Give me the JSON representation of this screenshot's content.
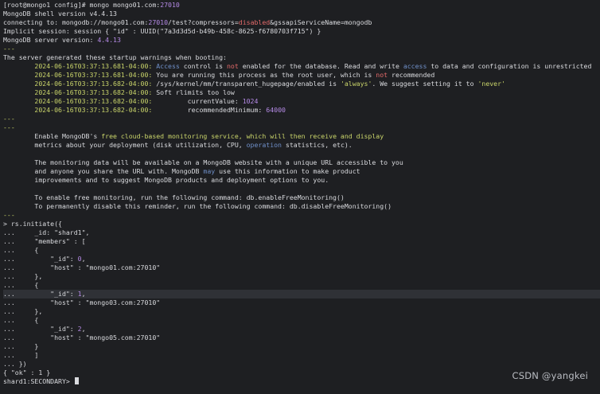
{
  "terminal": {
    "lines": [
      [
        {
          "t": "[root@mongo1 config]# ",
          "c": "host"
        },
        {
          "t": "mongo mongo01.com:",
          "c": "cmd"
        },
        {
          "t": "27010",
          "c": "num"
        }
      ],
      [
        {
          "t": "MongoDB shell version v4.4.13",
          "c": ""
        }
      ],
      [
        {
          "t": "connecting to: mongodb://mongo01.com:",
          "c": ""
        },
        {
          "t": "27010",
          "c": "num"
        },
        {
          "t": "/test?compressors=",
          "c": ""
        },
        {
          "t": "disabled",
          "c": "warn"
        },
        {
          "t": "&gssapiServiceName=mongodb",
          "c": ""
        }
      ],
      [
        {
          "t": "Implicit session: session { \"id\" : UUID(\"7a3d3d5d-b49b-458c-8625-f6780703f715\") }",
          "c": ""
        }
      ],
      [
        {
          "t": "MongoDB server version: ",
          "c": ""
        },
        {
          "t": "4.4.13",
          "c": "num"
        }
      ],
      [
        {
          "t": "---",
          "c": "dashes"
        }
      ],
      [
        {
          "t": "The server generated these startup warnings when booting:",
          "c": ""
        }
      ],
      [
        {
          "t": "        2024-06-16T03:37:13.681-04:00: ",
          "c": "time"
        },
        {
          "t": "Access",
          "c": "kw"
        },
        {
          "t": " control is ",
          "c": ""
        },
        {
          "t": "not",
          "c": "warn"
        },
        {
          "t": " enabled for the database. Read and write ",
          "c": ""
        },
        {
          "t": "access",
          "c": "kw"
        },
        {
          "t": " to data and configuration is unrestricted",
          "c": ""
        }
      ],
      [
        {
          "t": "        2024-06-16T03:37:13.681-04:00: ",
          "c": "time"
        },
        {
          "t": "You are running this process as the root user, which is ",
          "c": ""
        },
        {
          "t": "not",
          "c": "warn"
        },
        {
          "t": " recommended",
          "c": ""
        }
      ],
      [
        {
          "t": "        2024-06-16T03:37:13.682-04:00: ",
          "c": "time"
        },
        {
          "t": "/sys/kernel/mm/transparent_hugepage/enabled is ",
          "c": ""
        },
        {
          "t": "'always'",
          "c": "str"
        },
        {
          "t": ". We suggest setting it to ",
          "c": ""
        },
        {
          "t": "'never'",
          "c": "str"
        }
      ],
      [
        {
          "t": "        2024-06-16T03:37:13.682-04:00: ",
          "c": "time"
        },
        {
          "t": "Soft rlimits too low",
          "c": ""
        }
      ],
      [
        {
          "t": "        2024-06-16T03:37:13.682-04:00: ",
          "c": "time"
        },
        {
          "t": "        currentValue: ",
          "c": ""
        },
        {
          "t": "1024",
          "c": "num"
        }
      ],
      [
        {
          "t": "        2024-06-16T03:37:13.682-04:00: ",
          "c": "time"
        },
        {
          "t": "        recommendedMinimum: ",
          "c": ""
        },
        {
          "t": "64000",
          "c": "num"
        }
      ],
      [
        {
          "t": "---",
          "c": "dashes"
        }
      ],
      [
        {
          "t": "---",
          "c": "dashes"
        }
      ],
      [
        {
          "t": "        Enable MongoDB's ",
          "c": ""
        },
        {
          "t": "free cloud-based monitoring service, which will then receive and display",
          "c": "yellow"
        }
      ],
      [
        {
          "t": "        metrics about your deployment (disk utilization, CPU, ",
          "c": ""
        },
        {
          "t": "operation",
          "c": "kw"
        },
        {
          "t": " statistics, etc).",
          "c": ""
        }
      ],
      [
        {
          "t": "",
          "c": ""
        }
      ],
      [
        {
          "t": "        The monitoring data will be available on a MongoDB website with a unique URL accessible to you",
          "c": ""
        }
      ],
      [
        {
          "t": "        and anyone you share the URL with. MongoDB ",
          "c": ""
        },
        {
          "t": "may",
          "c": "kw"
        },
        {
          "t": " use this information to make product",
          "c": ""
        }
      ],
      [
        {
          "t": "        improvements and to suggest MongoDB products and deployment options to you.",
          "c": ""
        }
      ],
      [
        {
          "t": "",
          "c": ""
        }
      ],
      [
        {
          "t": "        To enable free monitoring, run the following command: db.enableFreeMonitoring()",
          "c": ""
        }
      ],
      [
        {
          "t": "        To permanently disable this reminder, run the following command: db.disableFreeMonitoring()",
          "c": ""
        }
      ],
      [
        {
          "t": "---",
          "c": "dashes"
        }
      ],
      [
        {
          "t": "> rs.initiate({",
          "c": ""
        }
      ],
      [
        {
          "t": "...     _id: \"shard1\",",
          "c": ""
        }
      ],
      [
        {
          "t": "...     \"members\" : [",
          "c": ""
        }
      ],
      [
        {
          "t": "...     {",
          "c": ""
        }
      ],
      [
        {
          "t": "...         \"_id\": ",
          "c": ""
        },
        {
          "t": "0",
          "c": "num"
        },
        {
          "t": ",",
          "c": ""
        }
      ],
      [
        {
          "t": "...         \"host\" : \"mongo01.com:27010\"",
          "c": ""
        }
      ],
      [
        {
          "t": "...     },",
          "c": ""
        }
      ],
      [
        {
          "t": "...     {",
          "c": ""
        }
      ],
      [
        {
          "t": "...         \"_id\": ",
          "c": ""
        },
        {
          "t": "1",
          "c": "num"
        },
        {
          "t": ",",
          "c": ""
        }
      ],
      [
        {
          "t": "...         \"host\" : \"mongo03.com:27010\"",
          "c": ""
        }
      ],
      [
        {
          "t": "...     },",
          "c": ""
        }
      ],
      [
        {
          "t": "...     {",
          "c": ""
        }
      ],
      [
        {
          "t": "...         \"_id\": ",
          "c": ""
        },
        {
          "t": "2",
          "c": "num"
        },
        {
          "t": ",",
          "c": ""
        }
      ],
      [
        {
          "t": "...         \"host\" : \"mongo05.com:27010\"",
          "c": ""
        }
      ],
      [
        {
          "t": "...     }",
          "c": ""
        }
      ],
      [
        {
          "t": "...     ]",
          "c": ""
        }
      ],
      [
        {
          "t": "... })",
          "c": ""
        }
      ],
      [
        {
          "t": "{ \"ok\" : 1 }",
          "c": ""
        }
      ],
      [
        {
          "t": "shard1:SECONDARY> ",
          "c": "prompt"
        }
      ]
    ],
    "highlight_line": 33
  },
  "watermark": "CSDN @yangkei",
  "colors": {
    "background": "#1e1f22",
    "text": "#d9dade",
    "number": "#b58ae6",
    "keyword": "#6f8fc8",
    "warning": "#e36a6a",
    "string": "#c9d46a"
  }
}
